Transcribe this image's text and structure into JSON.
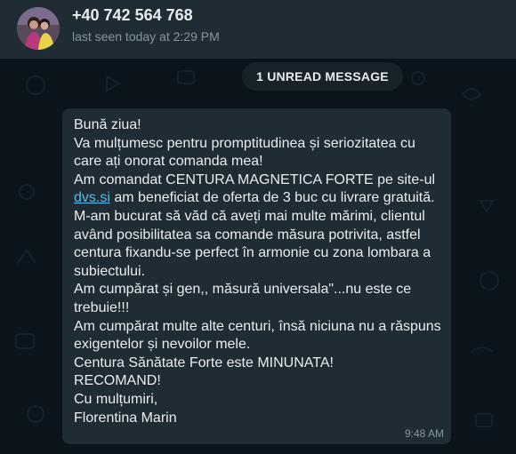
{
  "header": {
    "contact_name": "+40 742 564 768",
    "last_seen": "last seen today at 2:29 PM",
    "avatar_icon": "profile-photo"
  },
  "chat": {
    "unread_label": "1 UNREAD MESSAGE",
    "message": {
      "lines": [
        "Bună ziua!",
        "Va mulțumesc pentru promptitudinea și seriozitatea cu",
        "care ați onorat comanda mea!",
        "Am comandat CENTURA MAGNETICA FORTE pe site-ul",
        "am beneficiat de oferta de 3 buc cu livrare gratuită.",
        "M-am bucurat să văd că aveți mai multe mărimi, clientul",
        "având posibilitatea sa comande măsura potrivita, astfel",
        "centura fixandu-se perfect în armonie cu zona lombara a",
        "subiectului.",
        "Am cumpărat și gen,, măsură universala\"...nu este ce",
        "trebuie!!!",
        "Am cumpărat multe alte centuri, însă niciuna nu a răspuns",
        "exigentelor și nevoilor mele.",
        "Centura Sănătate Forte  este MINUNATA!",
        "RECOMAND!",
        "Cu mulțumiri,",
        "Florentina Marin"
      ],
      "link_text": "dvs.si",
      "time": "9:48 AM"
    }
  },
  "colors": {
    "background": "#0b141a",
    "header": "#202c33",
    "bubble": "#202c33",
    "link": "#53bdeb",
    "secondary_text": "#8696a0"
  }
}
